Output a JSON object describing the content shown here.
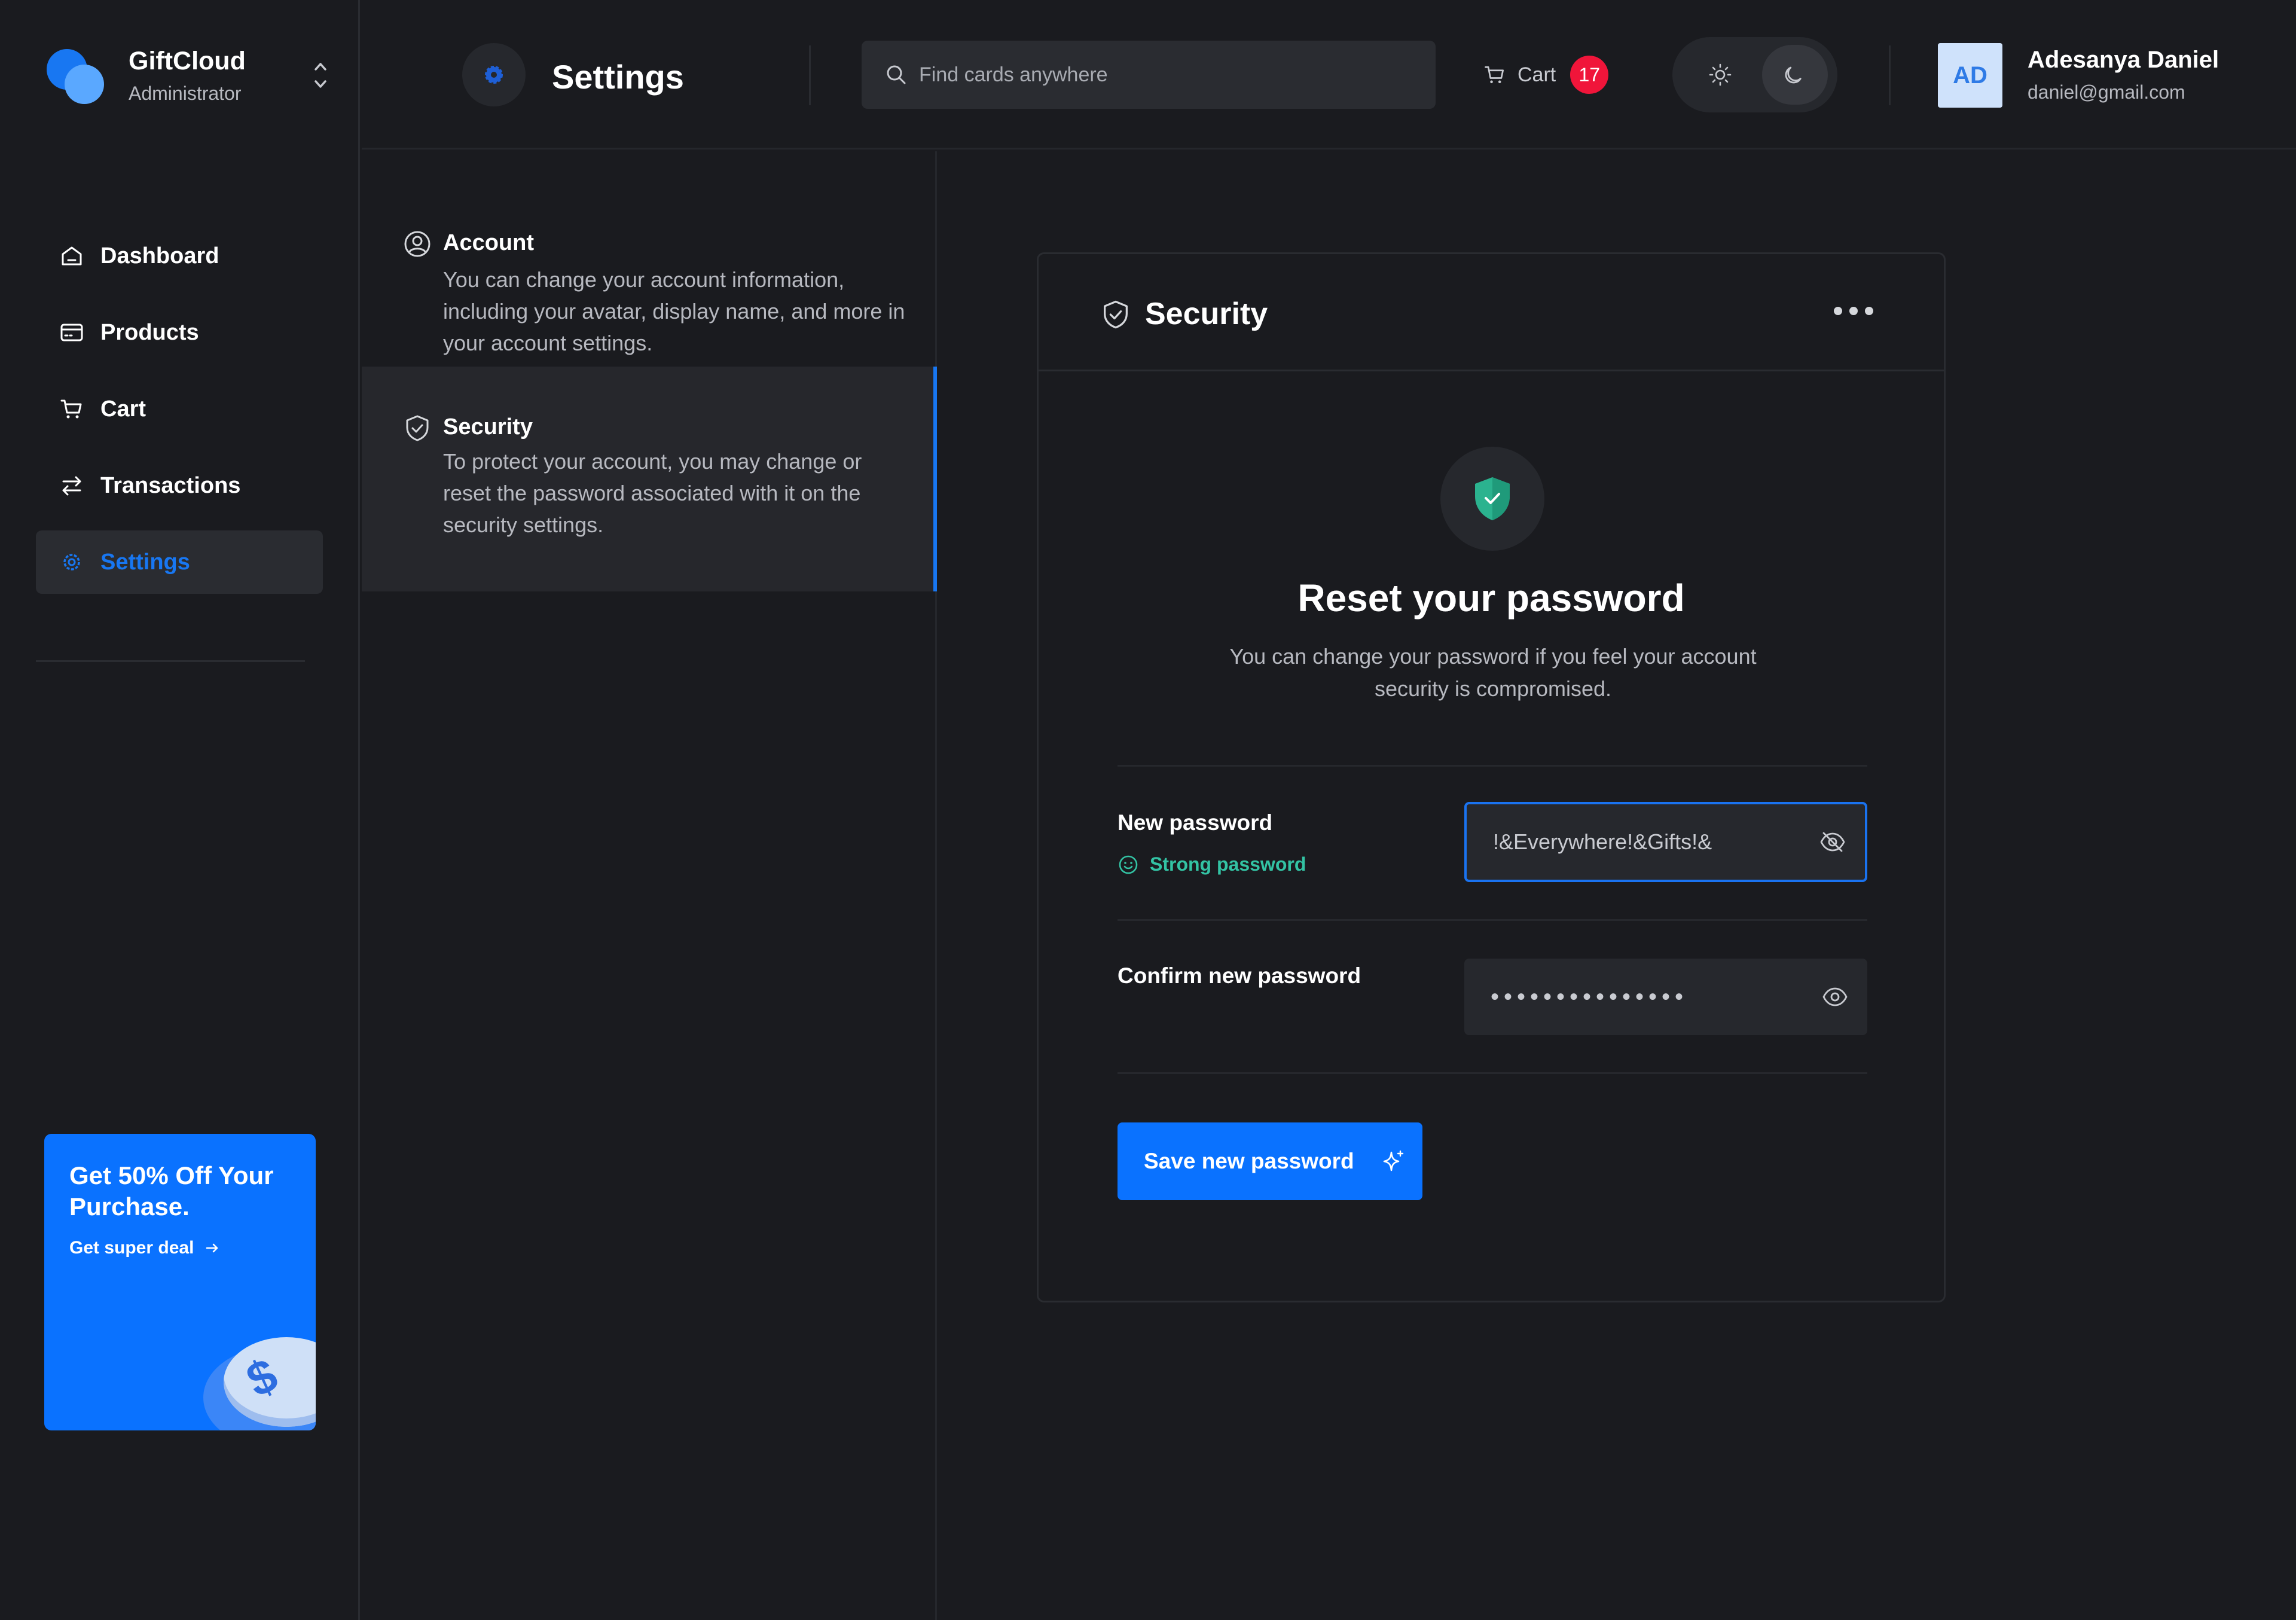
{
  "brand": {
    "name": "GiftCloud",
    "role": "Administrator"
  },
  "sidebar": {
    "items": [
      {
        "label": "Dashboard",
        "icon": "home-icon"
      },
      {
        "label": "Products",
        "icon": "card-icon"
      },
      {
        "label": "Cart",
        "icon": "cart-icon"
      },
      {
        "label": "Transactions",
        "icon": "transfer-icon"
      },
      {
        "label": "Settings",
        "icon": "gear-icon",
        "active": true
      }
    ]
  },
  "promo": {
    "title": "Get 50% Off Your Purchase.",
    "link_label": "Get super deal"
  },
  "header": {
    "title": "Settings",
    "search_placeholder": "Find cards anywhere",
    "cart_label": "Cart",
    "cart_count": "17",
    "theme": "dark"
  },
  "user": {
    "initials": "AD",
    "name": "Adesanya Daniel",
    "email": "daniel@gmail.com"
  },
  "settings_menu": {
    "account": {
      "title": "Account",
      "description": "You can change your account information, including your avatar, display name, and more in your account settings."
    },
    "security": {
      "title": "Security",
      "description": "To protect your account, you may change or reset the password associated with it on the security settings."
    }
  },
  "security_card": {
    "title": "Security",
    "reset_title": "Reset your password",
    "reset_description": "You can change your password if you feel your account security is compromised.",
    "new_password_label": "New password",
    "strength_label": "Strong password",
    "new_password_value": "!&Everywhere!&Gifts!&",
    "confirm_label": "Confirm new password",
    "confirm_value": "•••••••••••••••",
    "save_label": "Save new password"
  },
  "colors": {
    "background": "#1a1b1f",
    "accent": "#0a72ff",
    "badge": "#f0153a",
    "success": "#33c3a4",
    "panel": "#26282d"
  }
}
